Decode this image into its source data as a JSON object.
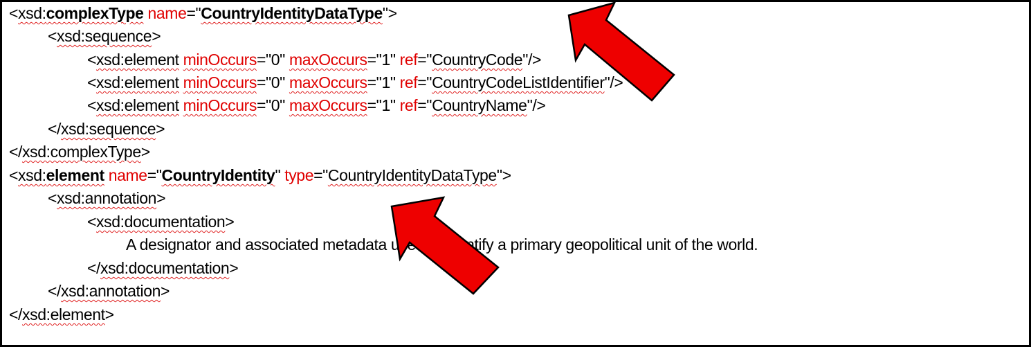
{
  "lines": [
    {
      "open": "<",
      "tag": "xsd:complexType",
      "attr1": " name",
      "eq1": "=\"",
      "val1": "CountryIdentityDataType",
      "close1": "\"",
      "end": ">"
    },
    {
      "open": "<",
      "tag": "xsd:sequence",
      "end": ">"
    },
    {
      "open": "<",
      "tag": "xsd:element",
      "a1": "minOccurs",
      "v1": "0",
      "a2": "maxOccurs",
      "v2": "1",
      "a3": "ref",
      "v3": "CountryCode",
      "end": "/>"
    },
    {
      "open": "<",
      "tag": "xsd:element",
      "a1": "minOccurs",
      "v1": "0",
      "a2": "maxOccurs",
      "v2": "1",
      "a3": "ref",
      "v3": "CountryCodeListIdentifier",
      "end": "/>"
    },
    {
      "open": "<",
      "tag": "xsd:element",
      "a1": "minOccurs",
      "v1": "0",
      "a2": "maxOccurs",
      "v2": "1",
      "a3": "ref",
      "v3": "CountryName",
      "end": "/>"
    },
    {
      "open": "</",
      "tag": "xsd:sequence",
      "end": ">"
    },
    {
      "open": "</",
      "tag": "xsd:complexType",
      "end": ">"
    },
    {
      "open": "<",
      "tag": "xsd:element",
      "a1": "name",
      "v1": "CountryIdentity",
      "a2": "type",
      "v2": "CountryIdentityDataType",
      "end": ">"
    },
    {
      "open": "<",
      "tag": "xsd:annotation",
      "end": ">"
    },
    {
      "open": "<",
      "tag": "xsd:documentation",
      "end": ">"
    },
    {
      "text": "A designator and associated metadata used to identify a primary geopolitical unit of the world."
    },
    {
      "open": "</",
      "tag": "xsd:documentation",
      "end": ">"
    },
    {
      "open": "</",
      "tag": "xsd:annotation",
      "end": ">"
    },
    {
      "open": "</",
      "tag": "xsd:element",
      "end": ">"
    }
  ],
  "colors": {
    "attribute": "#e00000",
    "arrow_fill": "#ee0000",
    "arrow_stroke": "#000000",
    "squiggle": "#e02020"
  },
  "annotations": [
    "arrow-pointing-to-complex-type-name",
    "arrow-pointing-to-element-name"
  ]
}
